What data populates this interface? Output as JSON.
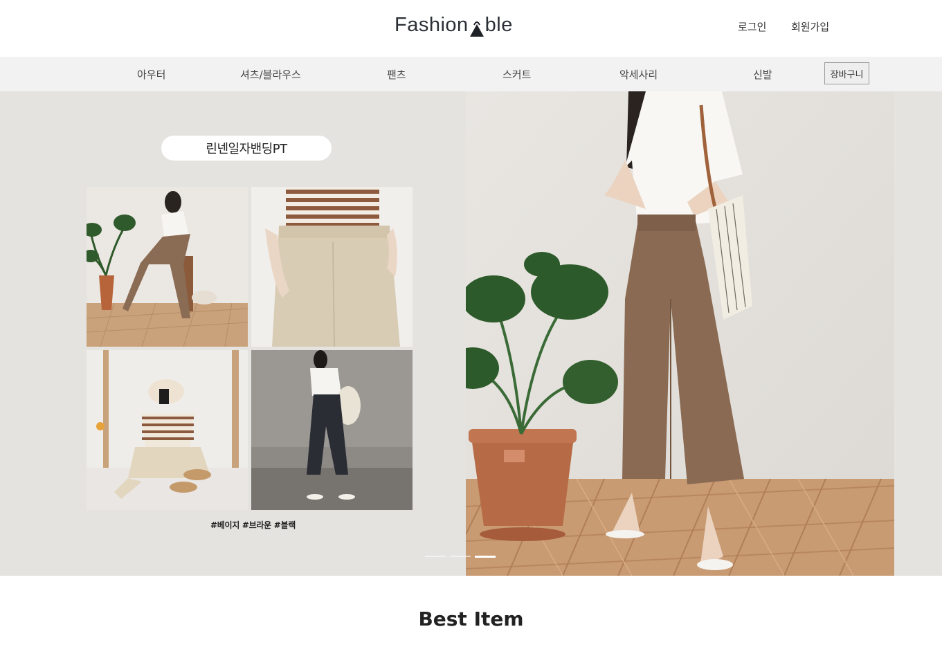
{
  "header": {
    "logo_text_before": "Fashion",
    "logo_text_after": "ble",
    "logo_text_full": "FashionAble",
    "login_label": "로그인",
    "signup_label": "회원가입"
  },
  "nav": {
    "items": [
      {
        "label": "아우터"
      },
      {
        "label": "셔츠/블라우스"
      },
      {
        "label": "팬츠"
      },
      {
        "label": "스커트"
      },
      {
        "label": "악세사리"
      },
      {
        "label": "신발"
      }
    ],
    "cart_label": "장바구니"
  },
  "hero": {
    "product_name": "린넨일자밴딩PT",
    "hashtags": "#베이지 #브라운 #블랙",
    "slide_count": 3,
    "active_slide": 3
  },
  "sections": {
    "best_item_title": "Best Item"
  },
  "colors": {
    "header_bg": "#ffffff",
    "nav_bg": "#f3f2f2",
    "hero_bg": "#e5e3e0",
    "text": "#333333"
  }
}
